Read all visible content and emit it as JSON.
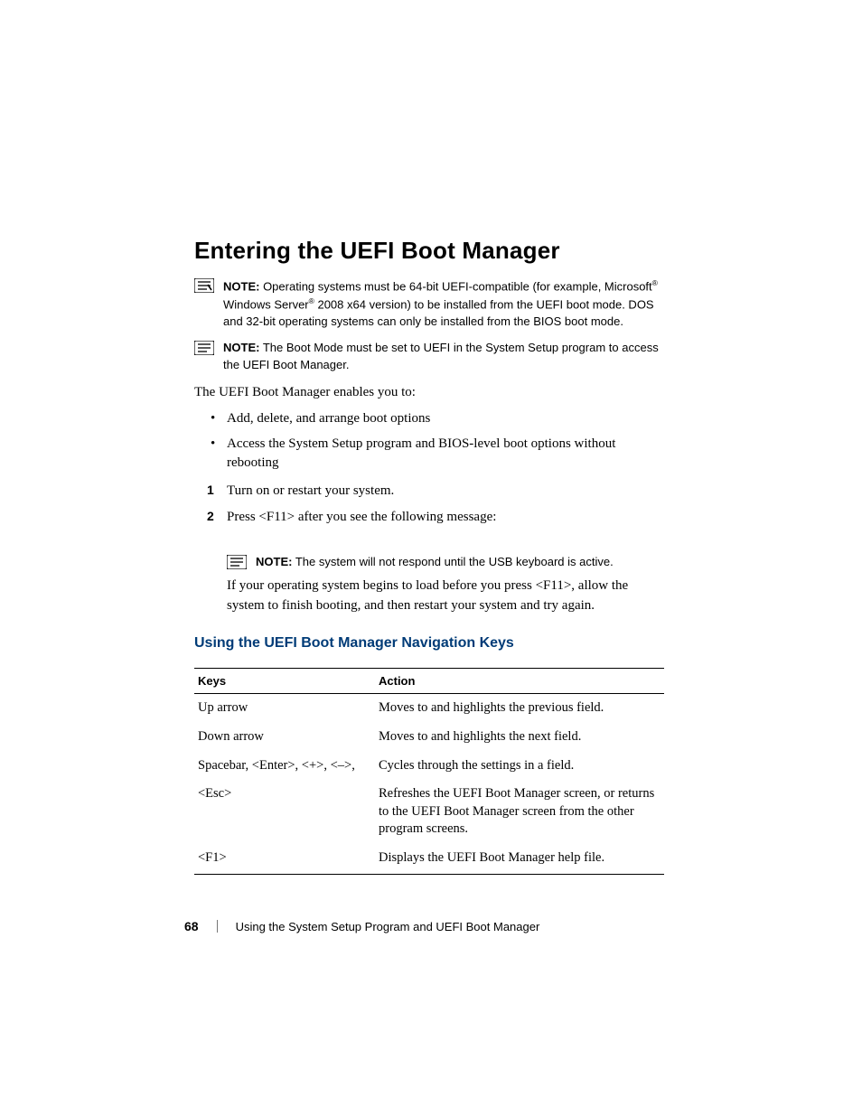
{
  "heading": "Entering the UEFI Boot Manager",
  "notes": {
    "n1_label": "NOTE:",
    "n1_pre": " Operating systems must be 64-bit UEFI-compatible (for example, Microsoft",
    "n1_mid": " Windows Server",
    "n1_post": " 2008 x64 version) to be installed from the UEFI boot mode. DOS and 32-bit operating systems can only be installed from the BIOS boot mode.",
    "n2_label": "NOTE:",
    "n2_text": " The Boot Mode must be set to UEFI in the System Setup program to access the UEFI Boot Manager.",
    "n3_label": "NOTE:",
    "n3_text": " The system will not respond until the USB keyboard is active."
  },
  "intro": "The UEFI Boot Manager enables you to:",
  "bullets": [
    "Add, delete, and arrange boot options",
    "Access the System Setup program and BIOS-level boot options without rebooting"
  ],
  "steps": [
    "Turn on or restart your system.",
    "Press <F11> after you see the following message:"
  ],
  "followup": "If your operating system begins to load before you press <F11>, allow the system to finish booting, and then restart your system and try again.",
  "subheading": "Using the UEFI Boot Manager Navigation Keys",
  "table": {
    "h1": "Keys",
    "h2": "Action",
    "rows": [
      {
        "k": "Up arrow",
        "a": "Moves to and highlights the previous field."
      },
      {
        "k": "Down arrow",
        "a": "Moves to and highlights the next field."
      },
      {
        "k": "Spacebar, <Enter>, <+>, <–>,",
        "a": "Cycles through the settings in a field."
      },
      {
        "k": "<Esc>",
        "a": "Refreshes the UEFI Boot Manager screen, or returns to the UEFI Boot Manager screen from the other program screens."
      },
      {
        "k": "<F1>",
        "a": "Displays the UEFI Boot Manager help file."
      }
    ]
  },
  "footer": {
    "page": "68",
    "title": "Using the System Setup Program and UEFI Boot Manager"
  },
  "glyphs": {
    "reg": "®"
  }
}
